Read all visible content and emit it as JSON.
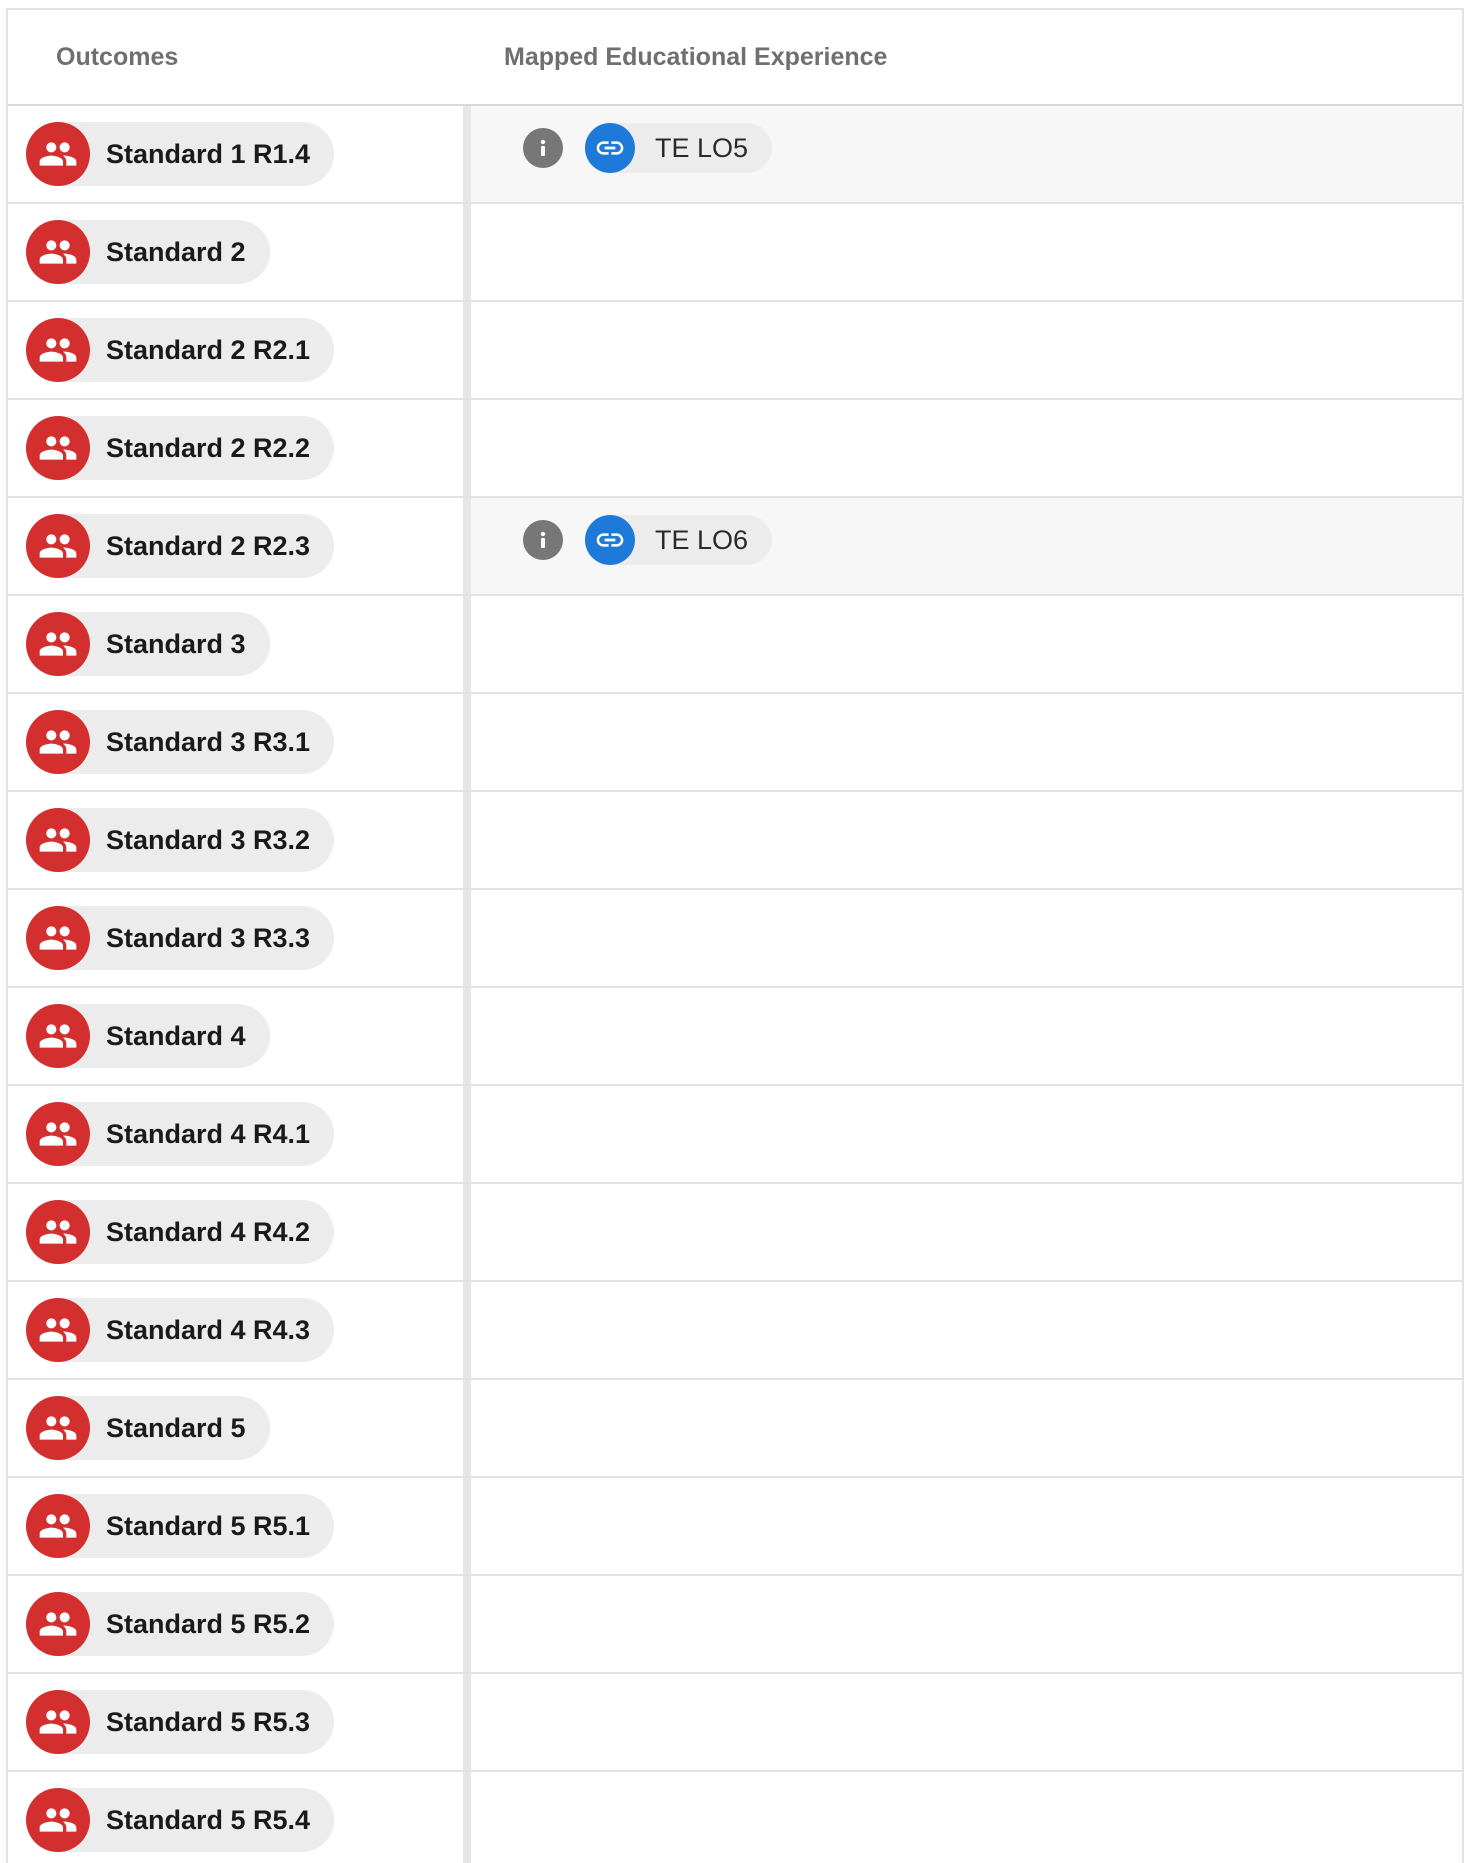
{
  "header": {
    "outcomes_label": "Outcomes",
    "mapped_label": "Mapped Educational Experience"
  },
  "colors": {
    "outcome_avatar": "#d32f2f",
    "link_avatar": "#1e7ad8",
    "info_icon": "#777777"
  },
  "icons": {
    "outcome": "group-icon",
    "info": "info-icon",
    "link": "link-icon"
  },
  "rows": [
    {
      "outcome": "Standard 1 R1.4",
      "mapped": "TE LO5"
    },
    {
      "outcome": "Standard 2",
      "mapped": null
    },
    {
      "outcome": "Standard 2 R2.1",
      "mapped": null
    },
    {
      "outcome": "Standard 2 R2.2",
      "mapped": null
    },
    {
      "outcome": "Standard 2 R2.3",
      "mapped": "TE LO6"
    },
    {
      "outcome": "Standard 3",
      "mapped": null
    },
    {
      "outcome": "Standard 3 R3.1",
      "mapped": null
    },
    {
      "outcome": "Standard 3 R3.2",
      "mapped": null
    },
    {
      "outcome": "Standard 3 R3.3",
      "mapped": null
    },
    {
      "outcome": "Standard 4",
      "mapped": null
    },
    {
      "outcome": "Standard 4 R4.1",
      "mapped": null
    },
    {
      "outcome": "Standard 4 R4.2",
      "mapped": null
    },
    {
      "outcome": "Standard 4 R4.3",
      "mapped": null
    },
    {
      "outcome": "Standard 5",
      "mapped": null
    },
    {
      "outcome": "Standard 5 R5.1",
      "mapped": null
    },
    {
      "outcome": "Standard 5 R5.2",
      "mapped": null
    },
    {
      "outcome": "Standard 5 R5.3",
      "mapped": null
    },
    {
      "outcome": "Standard 5 R5.4",
      "mapped": null
    }
  ]
}
